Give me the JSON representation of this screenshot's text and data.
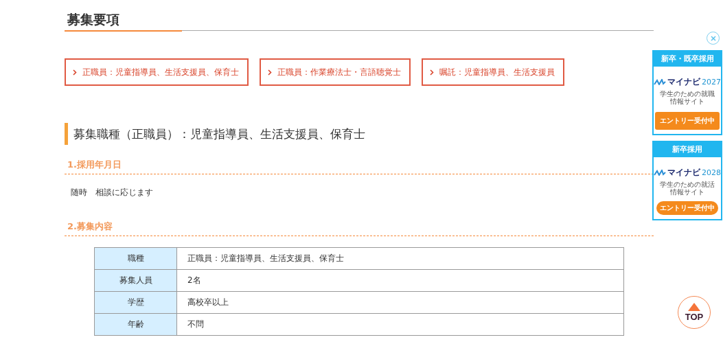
{
  "page_title": "募集要項",
  "job_links": [
    {
      "label": "正職員：児童指導員、生活支援員、保育士"
    },
    {
      "label": "正職員：作業療法士・言語聴覚士"
    },
    {
      "label": "嘱託：児童指導員、生活支援員"
    }
  ],
  "section": {
    "title": "募集職種（正職員）：児童指導員、生活支援員、保育士",
    "subsections": [
      {
        "heading": "1.採用年月日",
        "text": "随時　相談に応じます"
      },
      {
        "heading": "2.募集内容"
      }
    ]
  },
  "table": {
    "rows": [
      {
        "label": "職種",
        "value": "正職員：児童指導員、生活支援員、保育士"
      },
      {
        "label": "募集人員",
        "value": "2名"
      },
      {
        "label": "学歴",
        "value": "高校卒以上"
      },
      {
        "label": "年齢",
        "value": "不問"
      }
    ]
  },
  "side_banners": [
    {
      "header": "新卒・既卒採用",
      "brand": "マイナビ",
      "year": "2027",
      "tagline": "学生のための就職情報サイト",
      "button": "エントリー受付中",
      "kind": "square"
    },
    {
      "header": "新卒採用",
      "brand": "マイナビ",
      "year": "2028",
      "tagline": "学生のための就活情報サイト",
      "button": "エントリー受付中",
      "kind": "pill"
    }
  ],
  "top_button": {
    "label": "TOP"
  }
}
